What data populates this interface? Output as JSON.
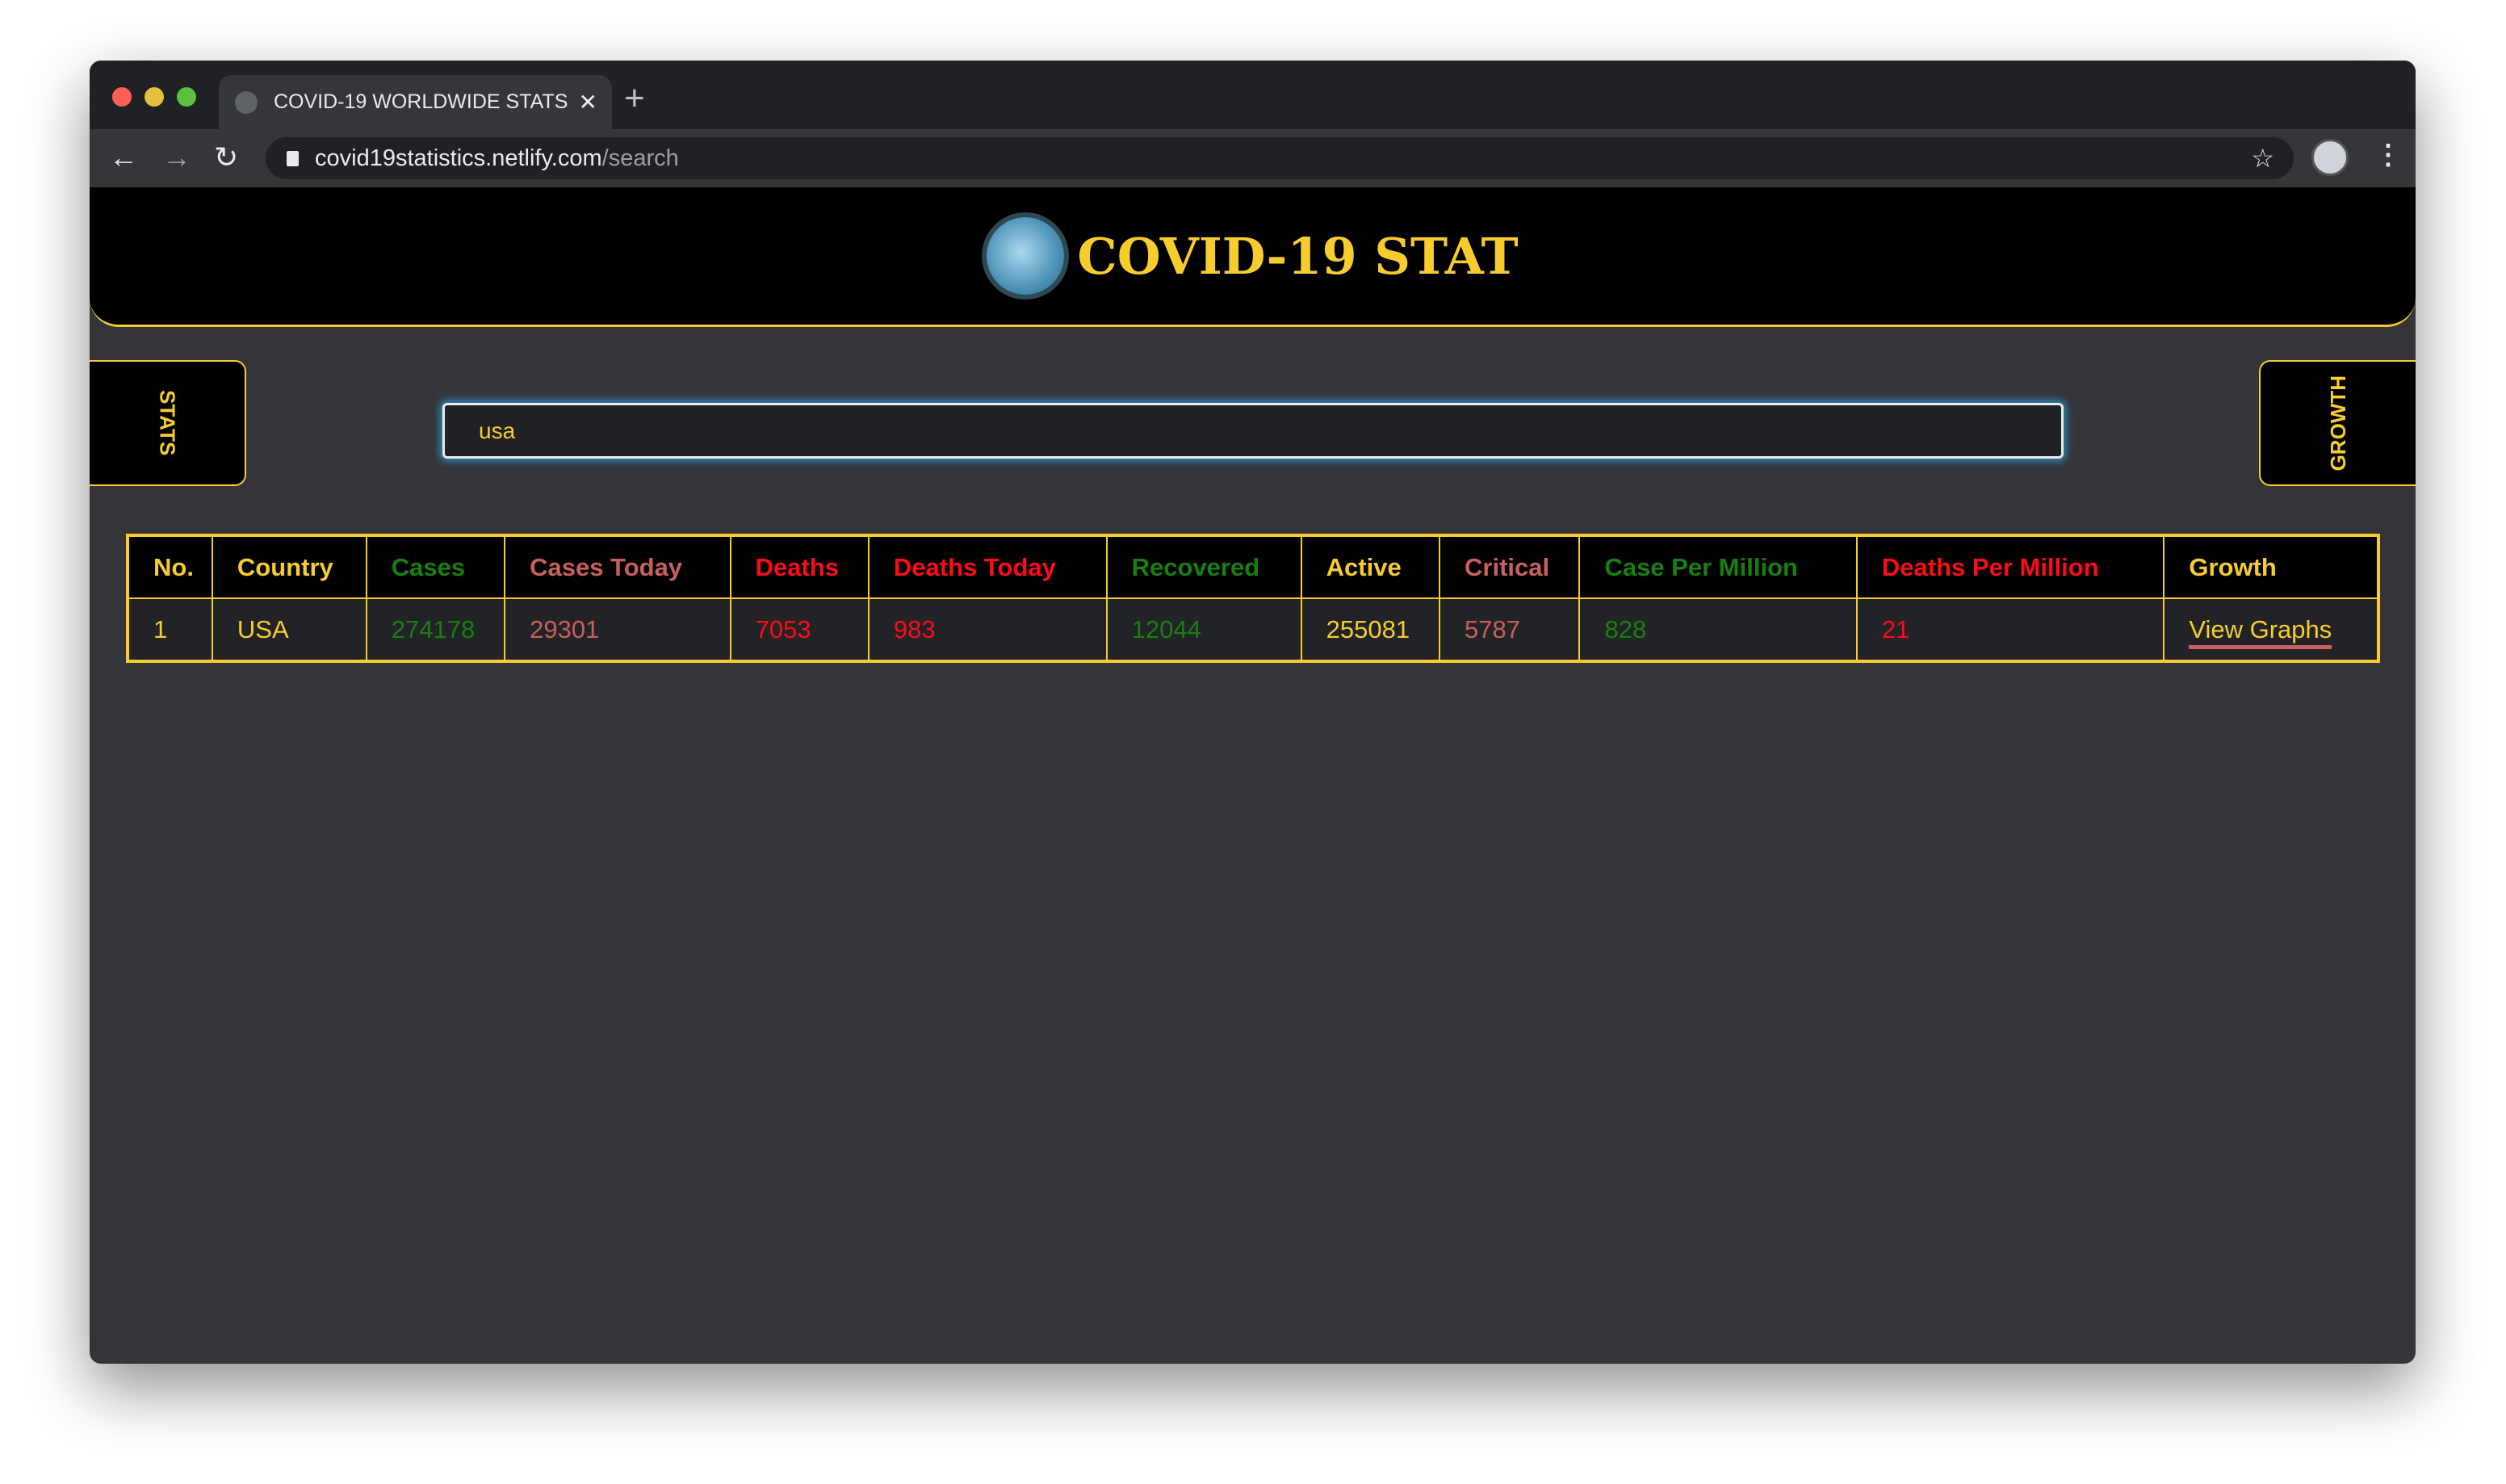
{
  "browser": {
    "tab_title": "COVID-19 WORLDWIDE STATS",
    "url_host": "covid19statistics.netlify.com",
    "url_path": "/search"
  },
  "header": {
    "title": "COVID-19 STAT"
  },
  "side_tabs": {
    "left": "STATS",
    "right": "GROWTH"
  },
  "search": {
    "value": "usa"
  },
  "colors": {
    "accent": "#f7cd2e",
    "green": "#17800f",
    "red": "#fe0b19",
    "salmon": "#c95f5f",
    "background": "#343539"
  },
  "table": {
    "headers": [
      "No.",
      "Country",
      "Cases",
      "Cases Today",
      "Deaths",
      "Deaths Today",
      "Recovered",
      "Active",
      "Critical",
      "Case Per Million",
      "Deaths Per Million",
      "Growth"
    ],
    "rows": [
      [
        "1",
        "USA",
        "274178",
        "29301",
        "7053",
        "983",
        "12044",
        "255081",
        "5787",
        "828",
        "21",
        "View Graphs"
      ]
    ]
  }
}
